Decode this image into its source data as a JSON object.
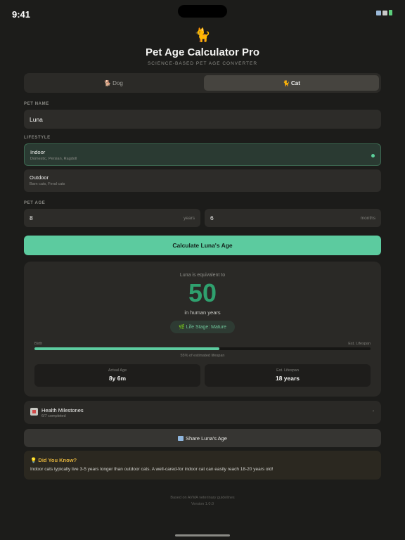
{
  "status_bar": {
    "time": "9:41"
  },
  "header": {
    "logo": "🐈",
    "title": "Pet Age Calculator Pro",
    "subtitle": "SCIENCE-BASED PET AGE CONVERTER"
  },
  "pet_type": {
    "options": [
      {
        "icon": "🐕",
        "label": "Dog",
        "selected": false
      },
      {
        "icon": "🐈",
        "label": "Cat",
        "selected": true
      }
    ]
  },
  "pet_name": {
    "label": "PET NAME",
    "value": "Luna"
  },
  "lifestyle": {
    "label": "LIFESTYLE",
    "options": [
      {
        "title": "Indoor",
        "subtitle": "Domestic, Persian, Ragdoll",
        "selected": true
      },
      {
        "title": "Outdoor",
        "subtitle": "Barn cats, Feral cats",
        "selected": false
      }
    ]
  },
  "pet_age": {
    "label": "PET AGE",
    "years": {
      "value": "8",
      "unit": "years"
    },
    "months": {
      "value": "6",
      "unit": "months"
    }
  },
  "calculate_button": "Calculate Luna's Age",
  "result": {
    "equivalent_text": "Luna is equivalent to",
    "human_age": "50",
    "human_text": "in human years",
    "life_stage": "🌿 Life Stage: Mature",
    "progress": {
      "start_label": "Birth",
      "end_label": "Est. Lifespan",
      "percent": 55,
      "caption": "55% of estimated lifespan"
    },
    "actual_age": {
      "label": "Actual Age",
      "value": "8y 6m"
    },
    "est_lifespan": {
      "label": "Est. Lifespan",
      "value": "18 years"
    }
  },
  "milestones": {
    "title": "Health Milestones",
    "subtitle": "6/7 completed",
    "chevron": "›"
  },
  "share_button": "Share Luna's Age",
  "did_you_know": {
    "title": "💡 Did You Know?",
    "text": "Indoor cats typically live 3-5 years longer than outdoor cats. A well-cared-for indoor cat can easily reach 18-20 years old!"
  },
  "footer": {
    "line1": "Based on AVMA veterinary guidelines",
    "line2": "Version 1.0.0"
  },
  "colors": {
    "accent": "#5ccb9f",
    "human_age": "#2fa06e",
    "tip_title": "#e0b13c",
    "background": "#1c1c1a"
  }
}
